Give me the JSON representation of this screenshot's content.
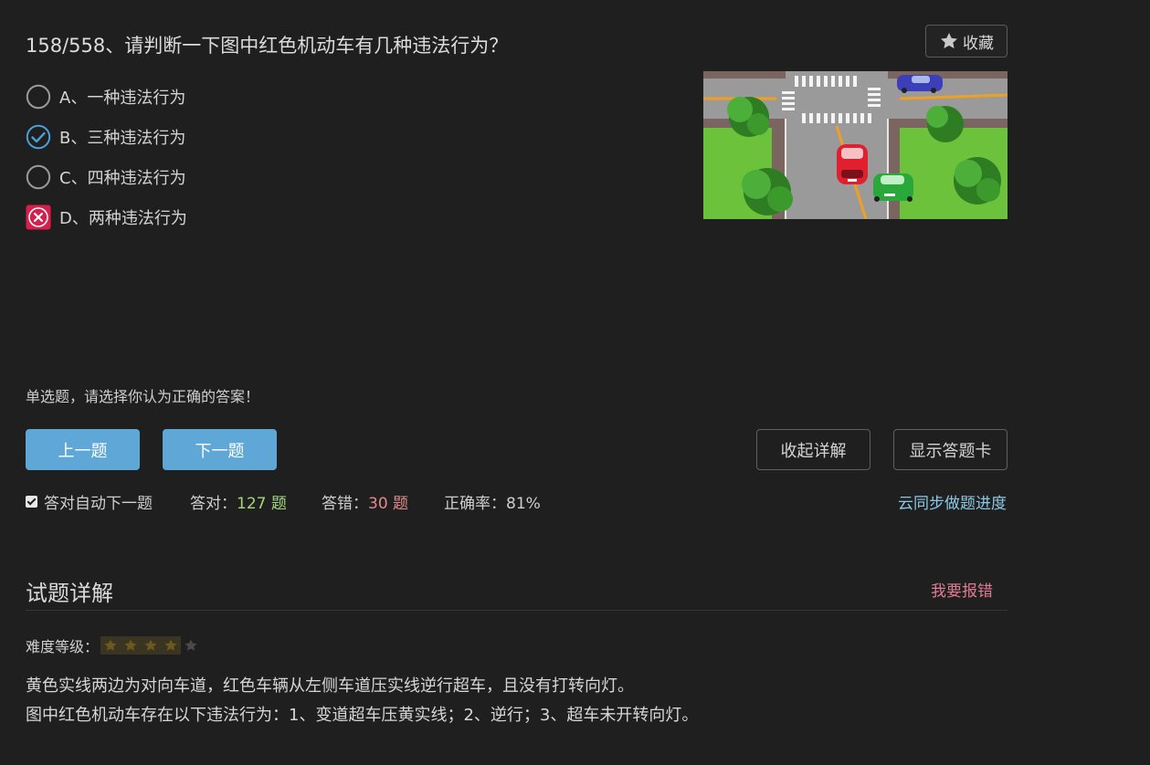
{
  "question": {
    "title": "158/558、请判断一下图中红色机动车有几种违法行为？",
    "favorite_label": "收藏",
    "options": [
      {
        "label": "A、一种违法行为",
        "state": "unselected"
      },
      {
        "label": "B、三种违法行为",
        "state": "correct"
      },
      {
        "label": "C、四种违法行为",
        "state": "unselected"
      },
      {
        "label": "D、两种违法行为",
        "state": "wrong"
      }
    ],
    "hint": "单选题，请选择你认为正确的答案！"
  },
  "nav": {
    "prev_label": "上一题",
    "next_label": "下一题",
    "collapse_label": "收起详解",
    "card_label": "显示答题卡"
  },
  "stats": {
    "auto_next_label": "答对自动下一题",
    "auto_next_checked": true,
    "correct_prefix": "答对：",
    "correct_value": "127 题",
    "wrong_prefix": "答错：",
    "wrong_value": "30 题",
    "accuracy_label": "正确率：81%",
    "sync_link": "云同步做题进度"
  },
  "details": {
    "title": "试题详解",
    "report_link": "我要报错",
    "difficulty_label": "难度等级：",
    "difficulty_stars": 4,
    "difficulty_max": 5,
    "line1": "黄色实线两边为对向车道，红色车辆从左侧车道压实线逆行超车，且没有打转向灯。",
    "line2": "图中红色机动车存在以下违法行为：1、变道超车压黄实线；2、逆行；3、超车未开转向灯。"
  },
  "colors": {
    "background": "#1f1f1f",
    "primary_button": "#5ea7d6",
    "correct_mark": "#4a9fd6",
    "wrong_mark": "#d81e4a",
    "count_correct": "#a3d97a",
    "count_wrong": "#e38a8a",
    "link": "#8cc8e6",
    "report": "#e07b96"
  }
}
